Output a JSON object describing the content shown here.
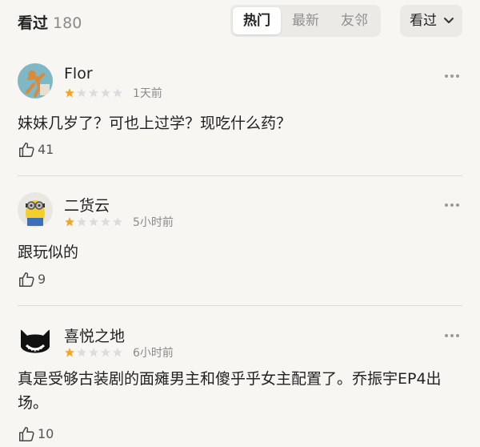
{
  "header": {
    "title": "看过",
    "count": "180",
    "tabs": [
      {
        "label": "热门",
        "active": true
      },
      {
        "label": "最新",
        "active": false
      },
      {
        "label": "友邻",
        "active": false
      }
    ],
    "filter_label": "看过",
    "filter_icon": "chevron-down-icon"
  },
  "colors": {
    "background": "#f7f6f3",
    "star_filled": "#f4a521",
    "star_empty": "#dcdcdc",
    "muted_text": "#8a8a8a"
  },
  "comments": [
    {
      "user": "Flor",
      "rating": 1,
      "max_rating": 5,
      "time": "1天前",
      "text": "妹妹几岁了？可也上过学？现吃什么药？",
      "likes": "41"
    },
    {
      "user": "二货云",
      "rating": 1,
      "max_rating": 5,
      "time": "5小时前",
      "text": "跟玩似的",
      "likes": "9"
    },
    {
      "user": "喜悦之地",
      "rating": 1,
      "max_rating": 5,
      "time": "6小时前",
      "text": "真是受够古装剧的面瘫男主和傻乎乎女主配置了。乔振宇EP4出场。",
      "likes": "10"
    }
  ]
}
